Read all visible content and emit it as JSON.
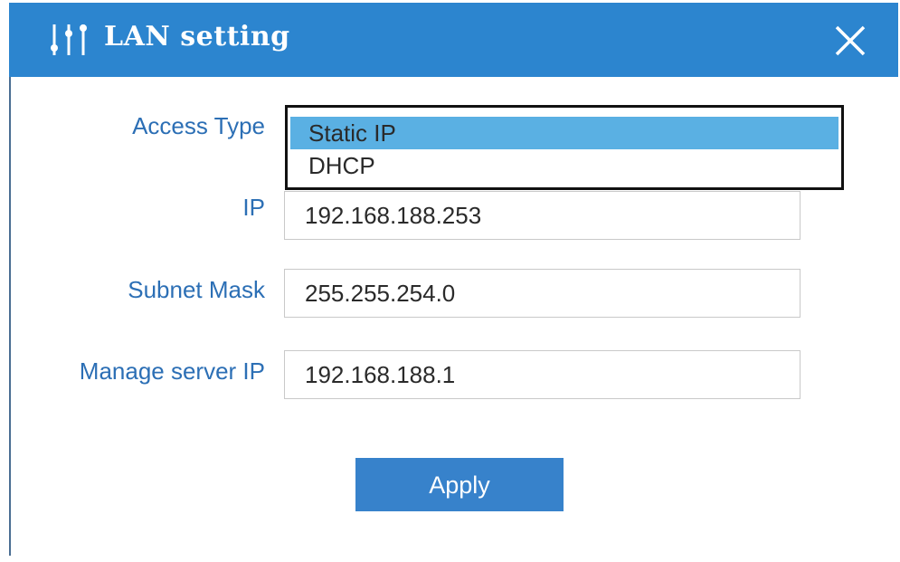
{
  "window": {
    "title": "LAN setting",
    "title_icon": "sliders-icon",
    "close_icon": "close-icon"
  },
  "form": {
    "access_type": {
      "label": "Access Type",
      "options": [
        "Static IP",
        "DHCP"
      ],
      "selected": "Static IP"
    },
    "ip": {
      "label": "IP",
      "value": "192.168.188.253"
    },
    "subnet_mask": {
      "label": "Subnet Mask",
      "value": "255.255.254.0"
    },
    "manage_server_ip": {
      "label": "Manage server IP",
      "value": "192.168.188.1"
    }
  },
  "actions": {
    "apply_label": "Apply"
  },
  "colors": {
    "titlebar": "#2c85cf",
    "label_text": "#2c6fb5",
    "selected_option": "#5ab0e3",
    "apply_button": "#3782cb"
  }
}
